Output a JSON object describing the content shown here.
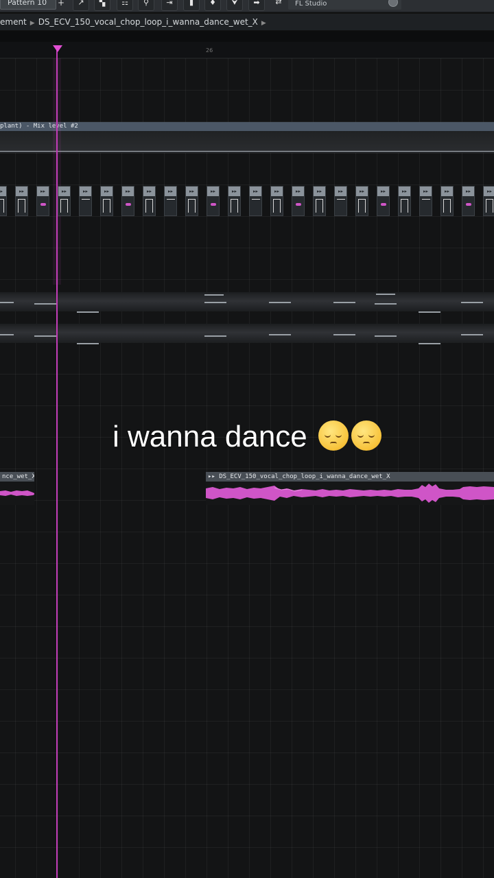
{
  "toolbar": {
    "pattern_label": "Pattern 10",
    "pattern_add": "+",
    "buttons": [
      "↗",
      "▚",
      "☷",
      "⚲",
      "⇥",
      "▮",
      "♦",
      "⮟",
      "➡",
      "⇄"
    ],
    "app_label": "FL Studio"
  },
  "breadcrumb": {
    "parent": "ement",
    "current": "DS_ECV_150_vocal_chop_loop_i_wanna_dance_wet_X"
  },
  "ruler": {
    "bar_number": "26"
  },
  "automation": {
    "label": "plant) - Mix level #2"
  },
  "caption": {
    "text": "i wanna dance"
  },
  "clips": [
    {
      "label": "nce_wet_X"
    },
    {
      "label": "▸▸ DS_ECV_150_vocal_chop_loop_i_wanna_dance_wet_X"
    }
  ],
  "pattern_blocks": {
    "header_glyph": "▸▸",
    "symbols": [
      "arch",
      "arch",
      "note",
      "arch",
      "line",
      "arch",
      "note",
      "arch",
      "line",
      "arch",
      "note",
      "arch",
      "line",
      "arch",
      "note",
      "arch",
      "line",
      "arch",
      "note",
      "arch",
      "line",
      "arch",
      "note",
      "arch"
    ]
  },
  "colors": {
    "playhead": "#c23cb8",
    "note_pink": "#cf55c7",
    "automation_header": "#4b5766",
    "background": "#131415"
  },
  "icons": [
    "pattern-add-icon",
    "fl-studio-knob-icon",
    "playhead-marker-icon",
    "emoji-relieved-icon"
  ]
}
